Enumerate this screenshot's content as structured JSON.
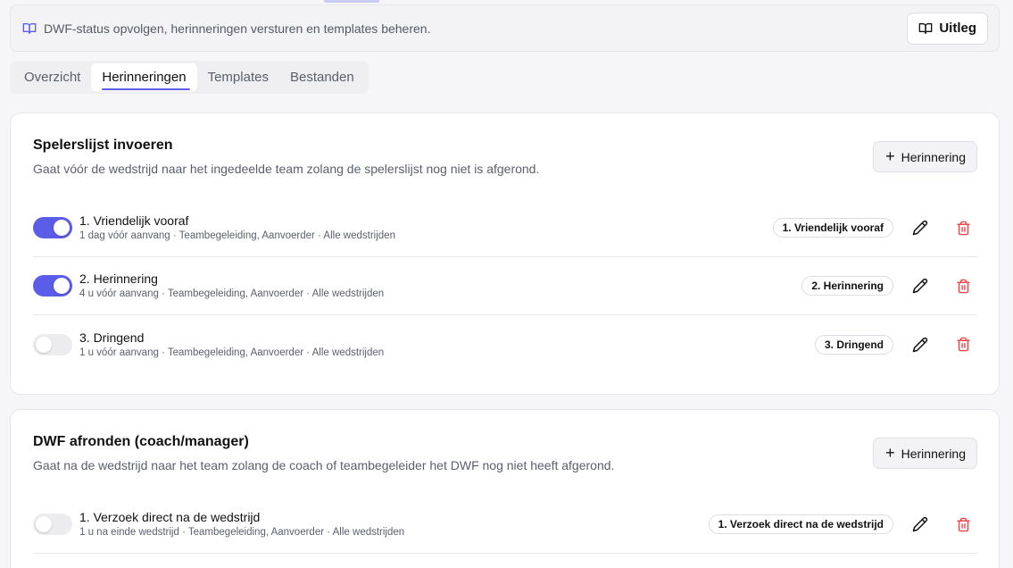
{
  "header": {
    "info_text": "DWF-status opvolgen, herinneringen versturen en templates beheren.",
    "uitleg_label": "Uitleg"
  },
  "tabs": [
    {
      "label": "Overzicht",
      "active": false
    },
    {
      "label": "Herinneringen",
      "active": true
    },
    {
      "label": "Templates",
      "active": false
    },
    {
      "label": "Bestanden",
      "active": false
    }
  ],
  "colors": {
    "accent": "#5b5ce8",
    "danger": "#e5484d",
    "toggle_off": "#ececef"
  },
  "icons": {
    "book": "book-open-icon",
    "plus": "plus-icon",
    "edit": "pencil-icon",
    "delete": "trash-icon"
  },
  "sections": [
    {
      "title": "Spelerslijst invoeren",
      "subtitle": "Gaat vóór de wedstrijd naar het ingedeelde team zolang de spelerslijst nog niet is afgerond.",
      "add_label": "Herinnering",
      "plus_glyph": "+",
      "reminders": [
        {
          "enabled": true,
          "title": "1. Vriendelijk vooraf",
          "meta": "1 dag vóór aanvang · Teambegeleiding, Aanvoerder · Alle wedstrijden",
          "badge": "1. Vriendelijk vooraf"
        },
        {
          "enabled": true,
          "title": "2. Herinnering",
          "meta": "4 u vóór aanvang · Teambegeleiding, Aanvoerder · Alle wedstrijden",
          "badge": "2. Herinnering"
        },
        {
          "enabled": false,
          "title": "3. Dringend",
          "meta": "1 u vóór aanvang · Teambegeleiding, Aanvoerder · Alle wedstrijden",
          "badge": "3. Dringend"
        }
      ]
    },
    {
      "title": "DWF afronden (coach/manager)",
      "subtitle": "Gaat na de wedstrijd naar het team zolang de coach of teambegeleider het DWF nog niet heeft afgerond.",
      "add_label": "Herinnering",
      "plus_glyph": "+",
      "reminders": [
        {
          "enabled": false,
          "title": "1. Verzoek direct na de wedstrijd",
          "meta": "1 u na einde wedstrijd · Teambegeleiding, Aanvoerder · Alle wedstrijden",
          "badge": "1. Verzoek direct na de wedstrijd"
        }
      ]
    }
  ]
}
